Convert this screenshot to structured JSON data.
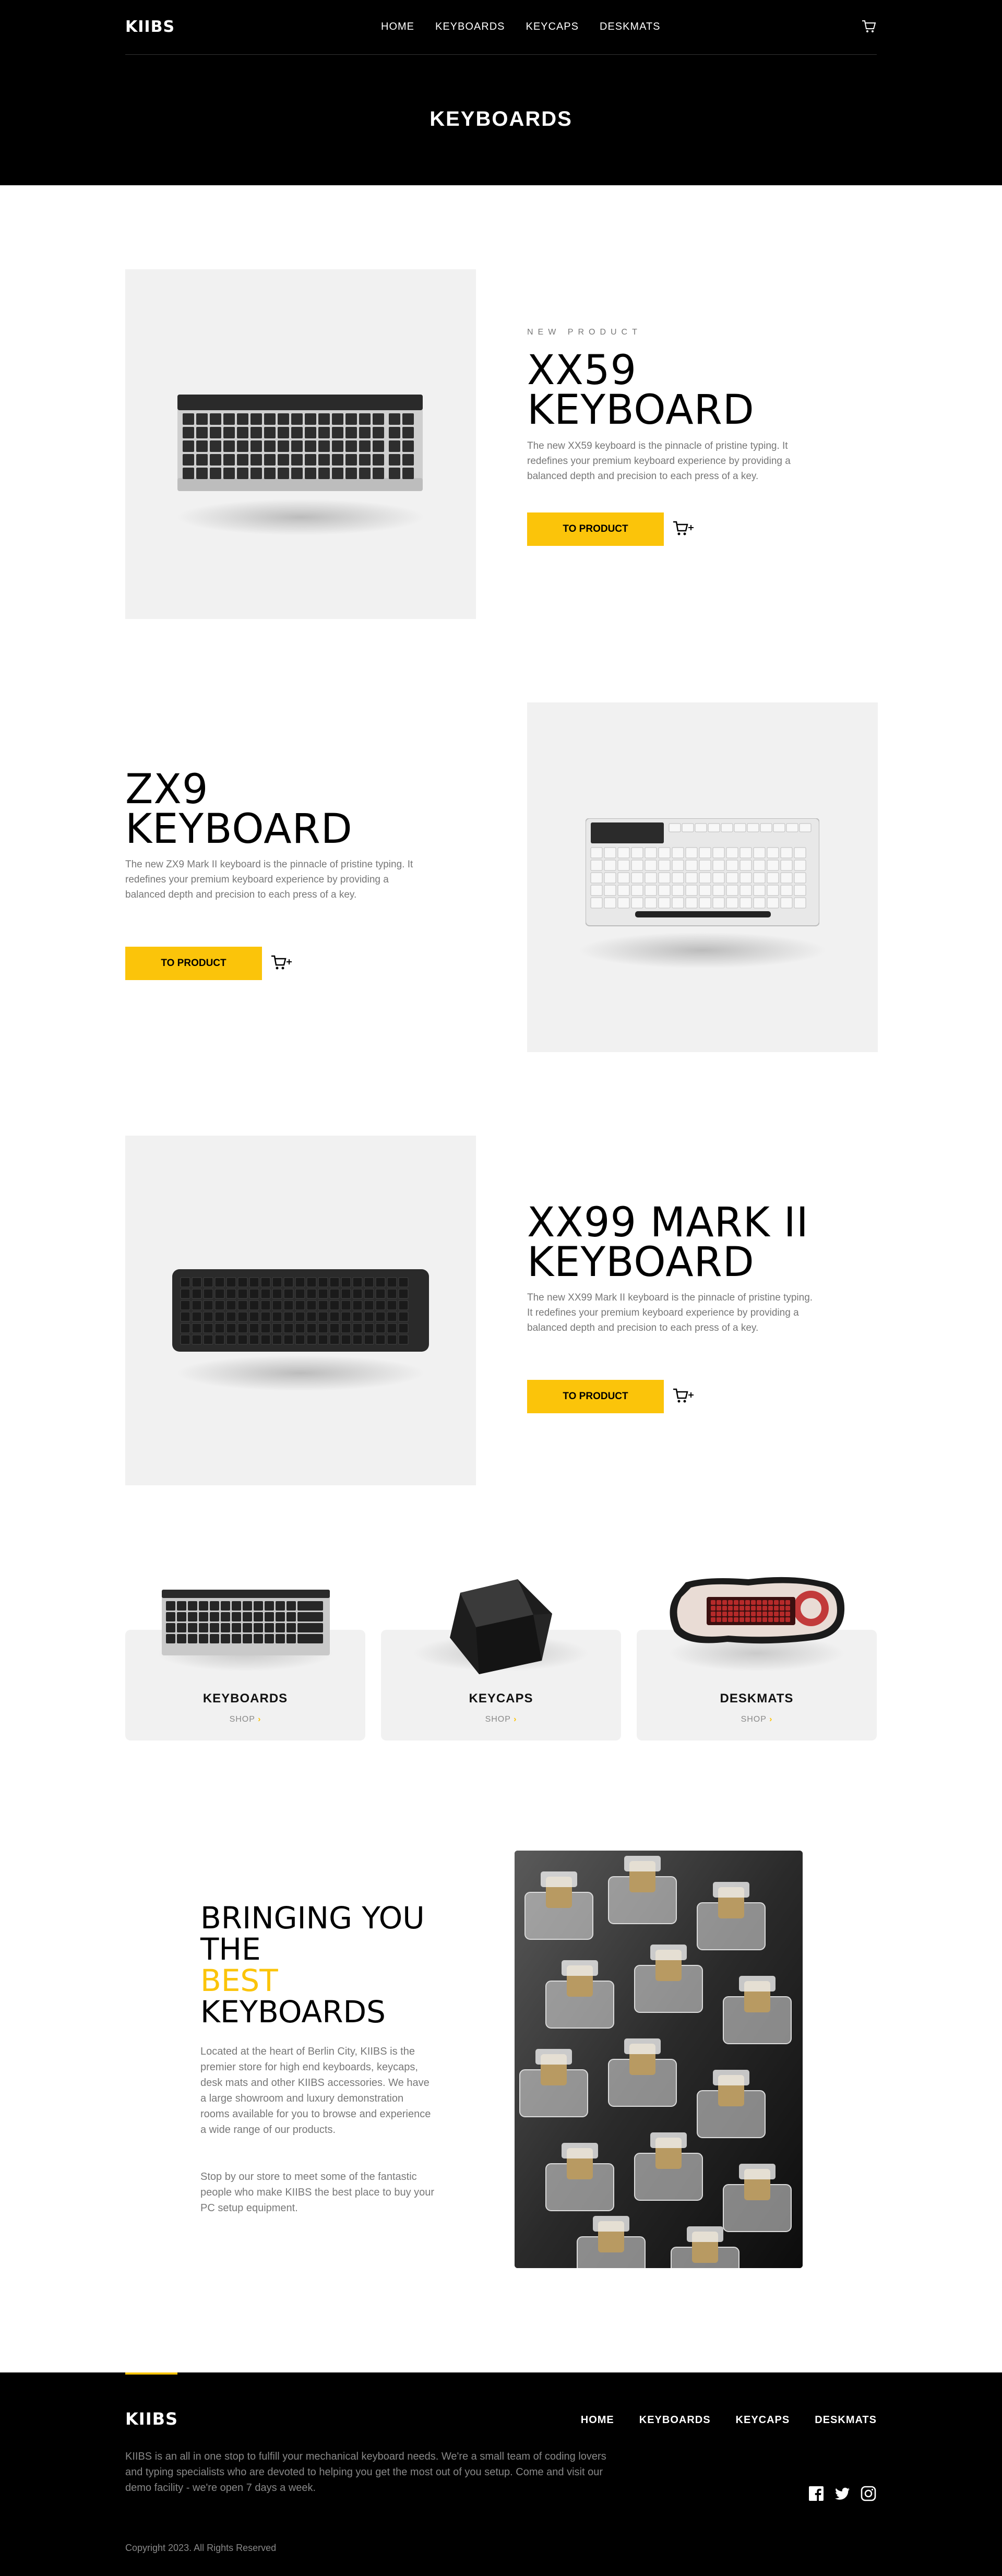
{
  "brand": {
    "logo": "KIIBS",
    "accent": "#fbc40a"
  },
  "nav": {
    "links": [
      "HOME",
      "KEYBOARDS",
      "KEYCAPS",
      "DESKMATS"
    ],
    "cart_icon": "cart-icon"
  },
  "page": {
    "title": "KEYBOARDS"
  },
  "products": [
    {
      "eyebrow": "NEW PRODUCT",
      "title_line1": "XX59",
      "title_line2": "KEYBOARD",
      "description": "The new XX59 keyboard is the pinnacle of pristine typing. It redefines your premium keyboard experience by providing a balanced depth and precision to each press of a key.",
      "button": "TO PRODUCT",
      "icon": "add-to-cart-icon"
    },
    {
      "eyebrow": "",
      "title_line1": "ZX9",
      "title_line2": "KEYBOARD",
      "description": "The new ZX9 Mark II keyboard is the pinnacle of pristine typing. It redefines your premium keyboard experience by providing a balanced depth and precision to each press of a key.",
      "button": "TO PRODUCT",
      "icon": "add-to-cart-icon"
    },
    {
      "eyebrow": "",
      "title_line1": "XX99 MARK II",
      "title_line2": "KEYBOARD",
      "description": "The new XX99 Mark II keyboard is the pinnacle of pristine typing. It redefines your premium keyboard experience by providing a balanced depth and precision to each press of a key.",
      "button": "TO PRODUCT",
      "icon": "add-to-cart-icon"
    }
  ],
  "categories": [
    {
      "title": "KEYBOARDS",
      "shop": "SHOP",
      "arrow": "›"
    },
    {
      "title": "KEYCAPS",
      "shop": "SHOP",
      "arrow": "›"
    },
    {
      "title": "DESKMATS",
      "shop": "SHOP",
      "arrow": "›"
    }
  ],
  "about": {
    "title_line1": "BRINGING YOU",
    "title_line2": "THE",
    "title_highlight": "BEST",
    "title_line4": "KEYBOARDS",
    "paragraph1": "Located at the heart of Berlin City, KIIBS is the premier store for high end keyboards, keycaps, desk mats and other KIIBS accessories. We have a large showroom and luxury demonstration rooms available for you to browse and experience a wide range of our products.",
    "paragraph2": "Stop by our store to meet some of the fantastic people who make KIIBS the best place to buy your PC setup equipment."
  },
  "footer": {
    "logo": "KIIBS",
    "links": [
      "HOME",
      "KEYBOARDS",
      "KEYCAPS",
      "DESKMATS"
    ],
    "description": "KIIBS is an all in one stop to fulfill your mechanical keyboard needs. We're a small team of coding lovers and typing specialists who are devoted to helping you get the most out of you setup. Come and visit our demo facility - we're open 7 days a week.",
    "social_icons": [
      "facebook-icon",
      "twitter-icon",
      "instagram-icon"
    ],
    "copyright": "Copyright 2023. All Rights Reserved"
  }
}
